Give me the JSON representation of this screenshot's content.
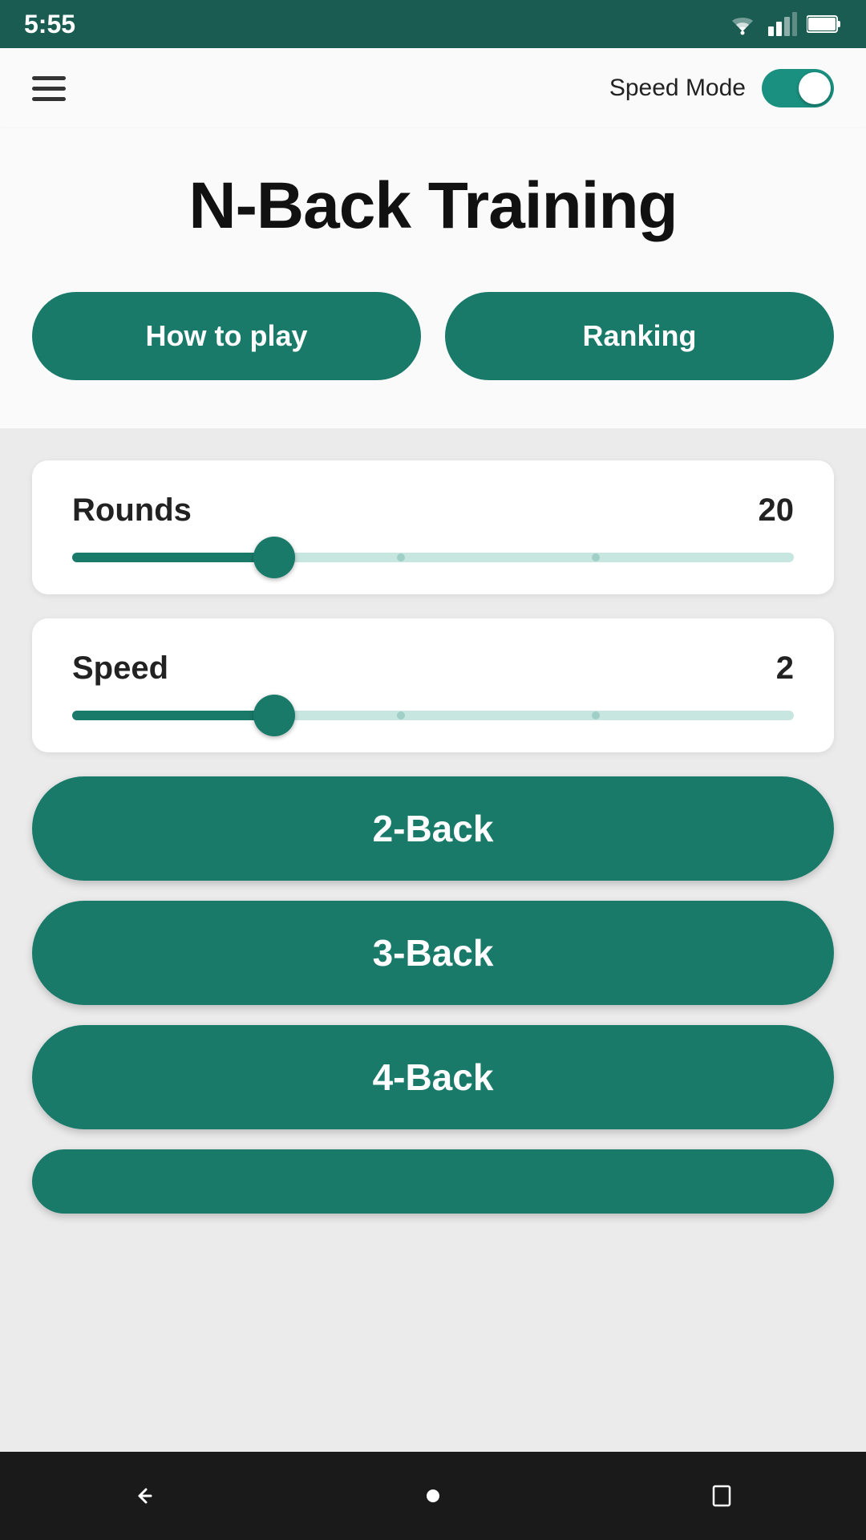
{
  "statusBar": {
    "time": "5:55"
  },
  "appBar": {
    "speedModeLabel": "Speed Mode",
    "speedModeEnabled": true
  },
  "hero": {
    "title": "N-Back Training",
    "howToPlayLabel": "How to play",
    "rankingLabel": "Ranking"
  },
  "roundsSlider": {
    "label": "Rounds",
    "value": "20",
    "fillPercent": 28,
    "thumbPercent": 28,
    "tick1Percent": 45,
    "tick2Percent": 72
  },
  "speedSlider": {
    "label": "Speed",
    "value": "2",
    "fillPercent": 28,
    "thumbPercent": 28,
    "tick1Percent": 45,
    "tick2Percent": 72
  },
  "gameButtons": [
    {
      "label": "2-Back"
    },
    {
      "label": "3-Back"
    },
    {
      "label": "4-Back"
    }
  ],
  "colors": {
    "teal": "#1a7a6a",
    "darkTeal": "#1a5c52"
  }
}
